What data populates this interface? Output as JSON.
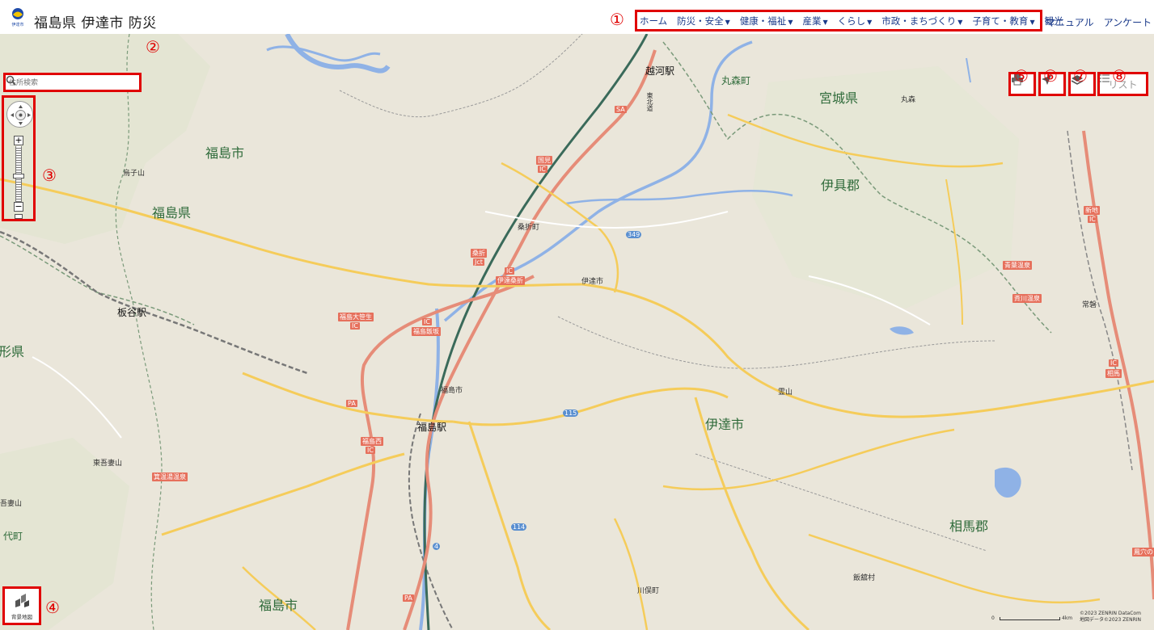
{
  "header": {
    "site_title": "福島県 伊達市 防災",
    "logo_text": "伊達市"
  },
  "nav": {
    "items": [
      {
        "label": "ホーム",
        "dropdown": false
      },
      {
        "label": "防災・安全",
        "dropdown": true
      },
      {
        "label": "健康・福祉",
        "dropdown": true
      },
      {
        "label": "産業",
        "dropdown": true
      },
      {
        "label": "くらし",
        "dropdown": true
      },
      {
        "label": "市政・まちづくり",
        "dropdown": true
      },
      {
        "label": "子育て・教育",
        "dropdown": true
      },
      {
        "label": "観光",
        "dropdown": false
      }
    ],
    "manual": "マニュアル",
    "survey": "アンケート"
  },
  "search": {
    "placeholder": "住所検索"
  },
  "tools": {
    "list_label": "リスト",
    "basemap_label": "背景地図"
  },
  "callouts": [
    "①",
    "②",
    "③",
    "④",
    "⑤",
    "⑥",
    "⑦",
    "⑧"
  ],
  "map_labels": {
    "fukushima_shi_1": "福島市",
    "fukushima_ken": "福島県",
    "miyagi_ken": "宮城県",
    "igu_gun": "伊具郡",
    "date_shi": "伊達市",
    "soma_gun": "相馬郡",
    "fukushima_shi_2": "福島市",
    "marumori_machi": "丸森町",
    "marumori": "丸森",
    "koshigo_eki": "越河駅",
    "itaya_eki": "板谷駅",
    "fukushima_eki": "福島駅",
    "fukushima_small": "福島市",
    "date_small": "伊達市",
    "kori_machi": "桑折町",
    "yamagata_ken": "形県",
    "iitate_mura": "飯舘村",
    "kawamata_machi": "川俣町",
    "ryozen": "霊山",
    "higashi_azuma": "東吾妻山",
    "eboshi": "烏子山",
    "jokoji": "常磐",
    "yoyo_machi": "代町",
    "azuma": "吾妻山"
  },
  "road_signs": {
    "kori_jct": "桑折",
    "kori_jct_sub": "Jct",
    "date_kori": "伊達桑折",
    "fukushima_iizaka": "福島飯坂",
    "fukushima_ohzasou": "福島大笹生",
    "fukushima_nishi": "福島西",
    "kunimi": "国見",
    "niichi": "新地",
    "soma": "相馬",
    "aoba_onsen": "青葉温泉",
    "saikawa_onsen": "斉川温泉",
    "fudou_onsen": "箕温湯温泉",
    "sakura_onsen": "鳳穴の",
    "route_349": "349",
    "route_115": "115",
    "route_114": "114",
    "route_4": "4",
    "ic": "IC",
    "pa": "PA",
    "sa": "SA",
    "tohoku": "東北道"
  },
  "attribution": {
    "line1": "©2023 ZENRIN DataCom",
    "line2": "地図データ©2023 ZENRIN",
    "scale_min": "0",
    "scale_max": "4km"
  },
  "colors": {
    "highlight": "#e00000",
    "nav_text": "#1a3a8a",
    "map_bg": "#eae6da",
    "expressway": "#e68c78",
    "prefectural_road": "#f5cc5a",
    "river": "#8fb2e6"
  }
}
